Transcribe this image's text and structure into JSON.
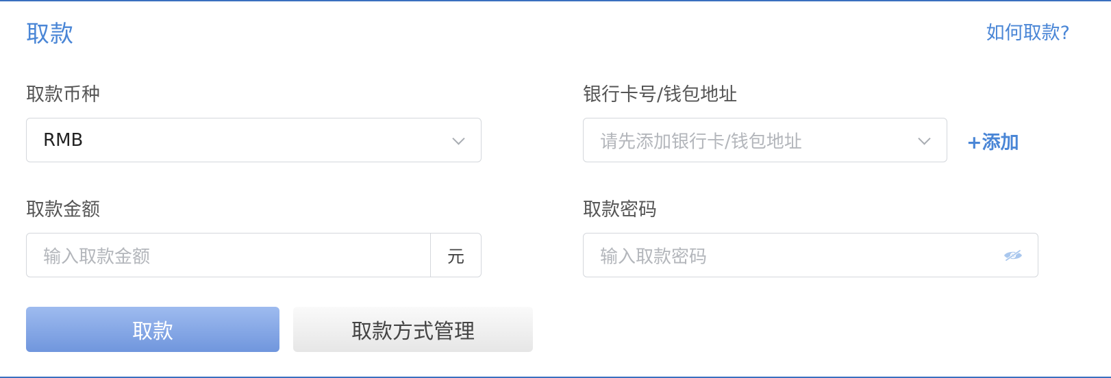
{
  "header": {
    "title": "取款",
    "help_link": "如何取款?"
  },
  "form": {
    "currency": {
      "label": "取款币种",
      "value": "RMB"
    },
    "bank_card": {
      "label": "银行卡号/钱包地址",
      "placeholder": "请先添加银行卡/钱包地址",
      "add_link": "+添加"
    },
    "amount": {
      "label": "取款金额",
      "placeholder": "输入取款金额",
      "unit": "元"
    },
    "password": {
      "label": "取款密码",
      "placeholder": "输入取款密码"
    }
  },
  "actions": {
    "submit_label": "取款",
    "manage_label": "取款方式管理"
  },
  "colors": {
    "accent": "#4a86d6",
    "frame_border": "#3a6fbf",
    "primary_button_top": "#9ebbef",
    "primary_button_bottom": "#7096dd",
    "placeholder": "#b3b6bb"
  },
  "icons": {
    "dropdown": "chevron-down-icon",
    "password_visibility": "eye-slash-icon"
  }
}
